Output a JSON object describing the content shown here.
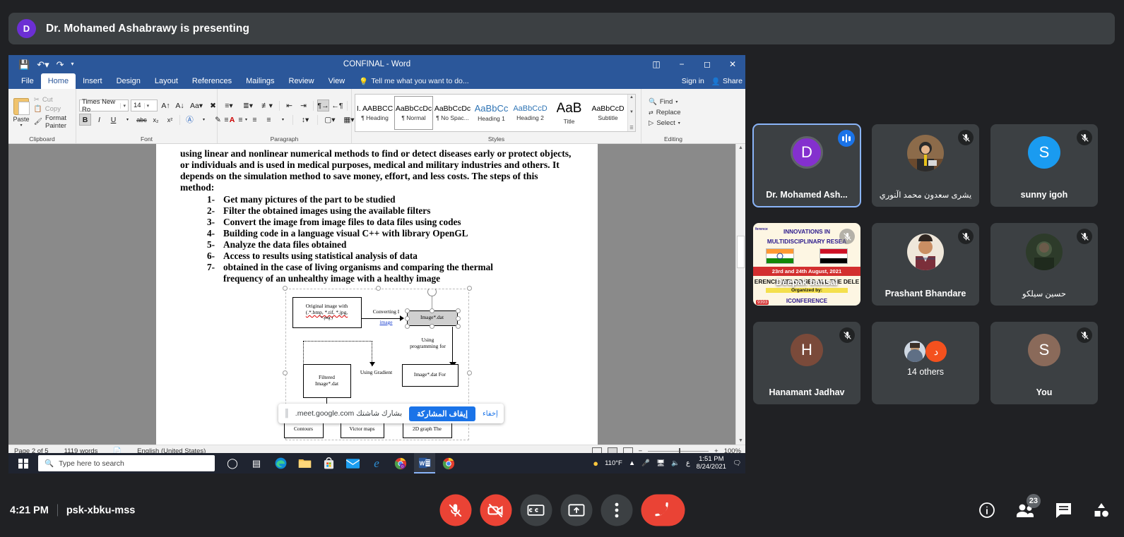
{
  "banner": {
    "avatar_letter": "D",
    "avatar_color": "#6c2fd4",
    "text": "Dr. Mohamed Ashabrawy is presenting"
  },
  "word": {
    "title": "CONFINAL - Word",
    "quick_access": [
      "save-icon",
      "undo-icon",
      "redo-icon",
      "customize-qat-icon"
    ],
    "window_controls": [
      "ribbon-display-options",
      "minimize",
      "restore",
      "close"
    ],
    "tabs": [
      "File",
      "Home",
      "Insert",
      "Design",
      "Layout",
      "References",
      "Mailings",
      "Review",
      "View"
    ],
    "active_tab": "Home",
    "tell_me": "Tell me what you want to do...",
    "sign_in": "Sign in",
    "share": "Share",
    "ribbon": {
      "clipboard": {
        "label": "Clipboard",
        "paste": "Paste",
        "items": [
          "Cut",
          "Copy",
          "Format Painter"
        ]
      },
      "font": {
        "label": "Font",
        "font_name": "Times New Ro",
        "font_size": "14",
        "buttons_row1": [
          "grow-font",
          "shrink-font",
          "change-case",
          "clear-formatting"
        ],
        "buttons_row2": [
          "B",
          "I",
          "U",
          "abc",
          "x₂",
          "x²",
          "text-effects",
          "highlight",
          "font-color"
        ]
      },
      "paragraph": {
        "label": "Paragraph",
        "buttons_row1": [
          "bullets",
          "numbering",
          "multilevel-list",
          "decrease-indent",
          "increase-indent",
          "ltr-text",
          "rtl-text",
          "sort"
        ],
        "buttons_row2": [
          "align-left",
          "center",
          "align-right",
          "justify",
          "line-spacing",
          "shading",
          "borders"
        ]
      },
      "styles": {
        "label": "Styles",
        "items": [
          {
            "preview": "I. AABBCC",
            "name": "¶ Heading",
            "color": "black",
            "selected": false
          },
          {
            "preview": "AaBbCcDc",
            "name": "¶ Normal",
            "color": "black",
            "selected": true
          },
          {
            "preview": "AaBbCcDc",
            "name": "¶ No Spac...",
            "color": "black",
            "selected": false
          },
          {
            "preview": "AaBbCc",
            "name": "Heading 1",
            "color": "blue",
            "selected": false
          },
          {
            "preview": "AaBbCcD",
            "name": "Heading 2",
            "color": "blue",
            "selected": false
          },
          {
            "preview": "AaB",
            "name": "Title",
            "color": "black",
            "selected": false
          },
          {
            "preview": "AaBbCcD",
            "name": "Subtitle",
            "color": "black",
            "selected": false
          }
        ]
      },
      "editing": {
        "label": "Editing",
        "items": [
          "Find",
          "Replace",
          "Select"
        ]
      }
    },
    "document": {
      "paragraph": "using linear and nonlinear numerical methods to find or detect diseases early or protect objects, or individuals and is used in medical purposes, medical and military industries and others. It depends on the simulation method to save money, effort, and less costs. The steps of this method:",
      "steps": [
        {
          "n": "1-",
          "text": "Get many pictures of the part to be studied"
        },
        {
          "n": "2-",
          "text": "Filter the obtained images using the available filters"
        },
        {
          "n": "3-",
          "text": "Convert the image from image files to data files using codes"
        },
        {
          "n": "4-",
          "text": "Building code in a language visual C++ with library OpenGL"
        },
        {
          "n": "5-",
          "text": "Analyze the data files obtained"
        },
        {
          "n": "6-",
          "text": "Access to results using statistical analysis of data"
        },
        {
          "n": "7-",
          "text": "obtained in the case of living organisms and comparing the thermal",
          "cont": "frequency of an unhealthy image with a healthy image"
        }
      ],
      "flowchart": {
        "original_box_l1": "Original image with",
        "original_box_l2": "(.*.bmp, *.tif, *.jpg,",
        "original_box_l3": "*.png  )",
        "converting_label_l1": "Converting I",
        "converting_label_l2": "image",
        "image_dat_box": "Image*.dat",
        "using_prog_l1": "Using",
        "using_prog_l2": "programming for",
        "filtered_box_l1": "Filtered",
        "filtered_box_l2": "Image*.dat",
        "gradient_label": "Using Gradient",
        "imagedat_for_box": "Image*.dat  For",
        "bottom_boxes": [
          "Contours",
          "Victor maps",
          "2D graph The"
        ]
      }
    },
    "status": {
      "page": "Page 2 of 5",
      "words": "1119 words",
      "proofing_icon": "proofing-errors-icon",
      "language": "English (United States)",
      "views": [
        "read-mode",
        "print-layout",
        "web-layout"
      ],
      "zoom_out": "−",
      "zoom_in": "+",
      "zoom_level": "100%"
    },
    "share_bar": {
      "message": "بشارك شاشتك meet.google.com.",
      "stop_button": "إيقاف المشاركة",
      "hide_link": "إخفاء",
      "grip_icon": "drag-grip-icon"
    }
  },
  "taskbar": {
    "start_icon": "windows-start-icon",
    "search_placeholder": "Type here to search",
    "pinned": [
      "cortana-icon",
      "task-view-icon",
      "edge-icon",
      "file-explorer-icon",
      "microsoft-store-icon",
      "mail-icon",
      "internet-explorer-icon",
      "chrome-opera-icon",
      "word-icon",
      "chrome-icon"
    ],
    "tray": {
      "weather_icon": "sun-icon",
      "temperature": "110°F",
      "overflow_icon": "show-hidden-icons-icon",
      "mic_icon": "microphone-icon",
      "network_icon": "network-icon",
      "volume_icon": "speaker-icon",
      "language": "ع",
      "time": "1:51 PM",
      "date": "8/24/2021",
      "notification_icon": "action-center-icon"
    }
  },
  "participants": [
    {
      "name": "Dr. Mohamed Ash...",
      "avatar_type": "letter",
      "letter": "D",
      "color": "#8430ce",
      "speaking": true,
      "muted": false,
      "rtl": false
    },
    {
      "name": "يشرى سعدون محمد الٓنوري",
      "avatar_type": "photo",
      "photo": "woman-photo",
      "muted": true,
      "rtl": true
    },
    {
      "name": "sunny igoh",
      "avatar_type": "letter",
      "letter": "S",
      "color": "#1a9bf0",
      "muted": true,
      "rtl": false
    },
    {
      "name": "Deepak bansal",
      "avatar_type": "banner",
      "muted": true,
      "rtl": false
    },
    {
      "name": "Prashant Bhandare",
      "avatar_type": "photo",
      "photo": "man-photo",
      "muted": true,
      "rtl": false
    },
    {
      "name": "حسين سيلكو",
      "avatar_type": "photo",
      "photo": "dark-photo",
      "muted": true,
      "rtl": true
    },
    {
      "name": "Hanamant Jadhav",
      "avatar_type": "letter",
      "letter": "H",
      "color": "#7a4a3a",
      "muted": true,
      "rtl": false
    },
    {
      "name": "14 others",
      "avatar_type": "others",
      "muted": false,
      "rtl": false
    },
    {
      "name": "You",
      "avatar_type": "letter",
      "letter": "S",
      "color": "#8a6a5a",
      "muted": true,
      "rtl": false
    }
  ],
  "banner_tile": {
    "line1": "INNOVATIONS IN",
    "line2": "MULTIDISCIPLINARY RESEA",
    "date": "23rd and 24th August, 2021",
    "welcome": "ERENCE WELCOMES ALL THE DELE",
    "organized": "Organized by:",
    "conference": "ICONFERENCE",
    "code": "9393",
    "left_mark": "ference"
  },
  "meet_bar": {
    "time": "4:21 PM",
    "meeting_code": "psk-xbku-mss",
    "controls": [
      {
        "name": "mic-off-button",
        "icon": "mic-off-icon",
        "state": "off"
      },
      {
        "name": "camera-off-button",
        "icon": "camera-off-icon",
        "state": "off"
      },
      {
        "name": "captions-button",
        "icon": "closed-captions-icon",
        "state": "idle"
      },
      {
        "name": "present-button",
        "icon": "present-screen-icon",
        "state": "idle"
      },
      {
        "name": "more-options-button",
        "icon": "more-vertical-icon",
        "state": "idle"
      },
      {
        "name": "leave-call-button",
        "icon": "hangup-icon",
        "state": "danger"
      }
    ],
    "right_controls": [
      {
        "name": "meeting-details-button",
        "icon": "info-icon",
        "badge": null
      },
      {
        "name": "participants-button",
        "icon": "people-icon",
        "badge": "23"
      },
      {
        "name": "chat-button",
        "icon": "chat-icon",
        "badge": null
      },
      {
        "name": "activities-button",
        "icon": "activities-icon",
        "badge": null
      }
    ]
  }
}
